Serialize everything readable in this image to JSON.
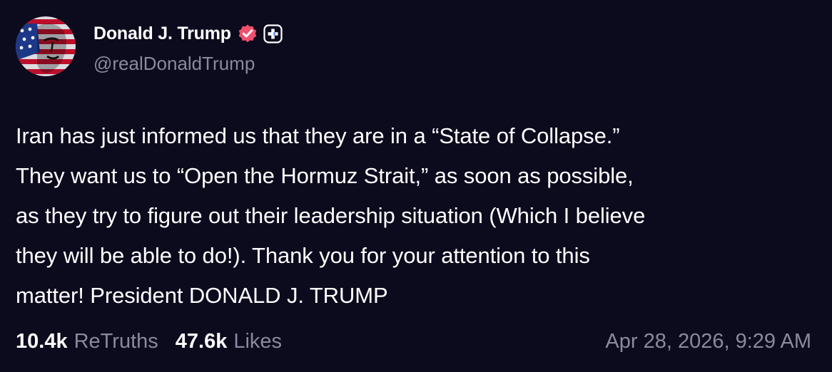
{
  "author": {
    "display_name": "Donald J. Trump",
    "handle": "@realDonaldTrump",
    "verified": true
  },
  "post": {
    "text": "Iran has just informed us that they are in a “State of Collapse.”\nThey want us to “Open the Hormuz Strait,” as soon as possible,\nas they try to figure out their leadership situation (Which I believe\nthey will be able to do!). Thank you for your attention to this\nmatter! President DONALD J. TRUMP"
  },
  "stats": {
    "retruths_count": "10.4k",
    "retruths_label": "ReTruths",
    "likes_count": "47.6k",
    "likes_label": "Likes"
  },
  "timestamp": "Apr 28, 2026, 9:29 AM",
  "colors": {
    "background": "#0c0a1d",
    "primary_text": "#ffffff",
    "secondary_text": "#8a8a9c",
    "verified_badge": "#f0506e"
  },
  "icons": {
    "verified": "verified-badge-icon",
    "plus": "plus-badge-icon",
    "avatar": "profile-avatar"
  }
}
